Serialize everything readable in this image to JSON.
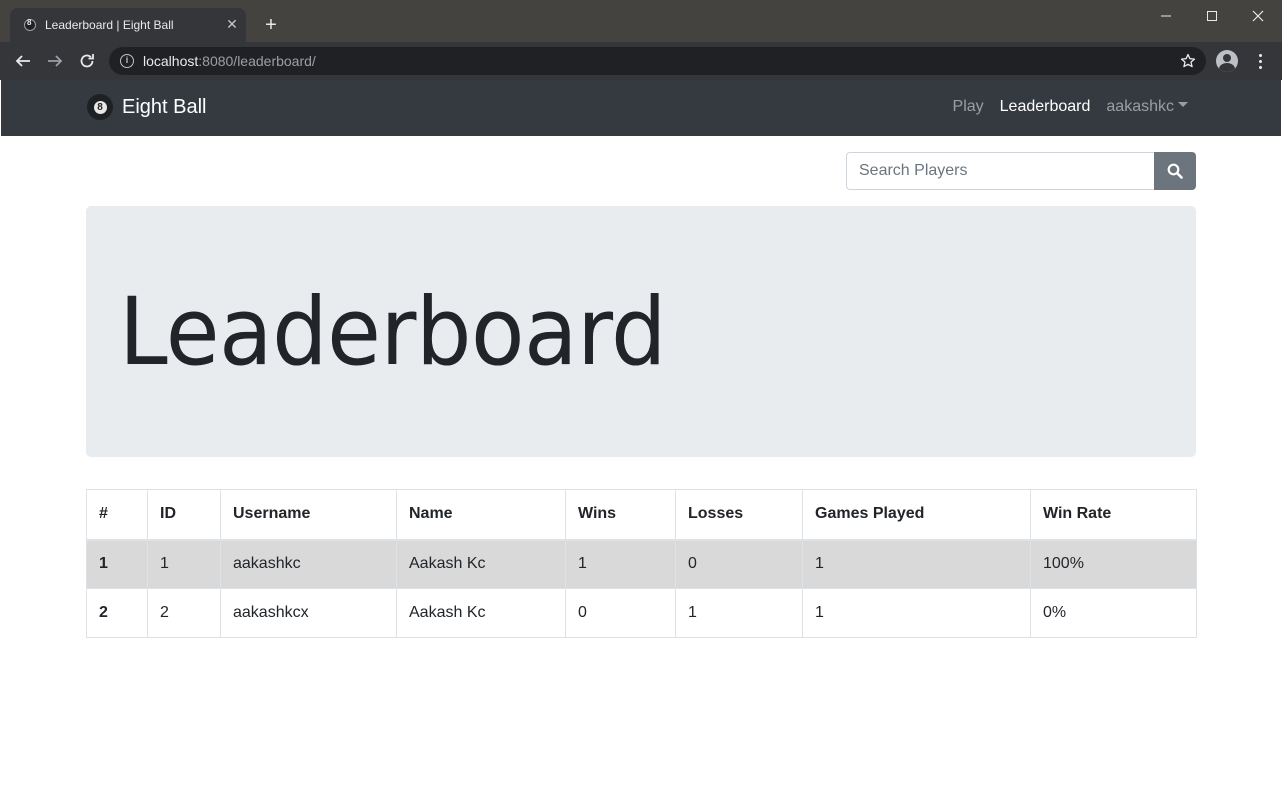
{
  "browser": {
    "tab_title": "Leaderboard | Eight Ball",
    "url_host": "localhost",
    "url_rest": ":8080/leaderboard/"
  },
  "navbar": {
    "brand": "Eight Ball",
    "brand_ball_number": "8",
    "links": {
      "play": "Play",
      "leaderboard": "Leaderboard",
      "user": "aakashkc"
    }
  },
  "search": {
    "placeholder": "Search Players"
  },
  "jumbotron": {
    "title": "Leaderboard"
  },
  "table": {
    "headers": [
      "#",
      "ID",
      "Username",
      "Name",
      "Wins",
      "Losses",
      "Games Played",
      "Win Rate"
    ],
    "rows": [
      [
        "1",
        "1",
        "aakashkc",
        "Aakash Kc",
        "1",
        "0",
        "1",
        "100%"
      ],
      [
        "2",
        "2",
        "aakashkcx",
        "Aakash Kc",
        "0",
        "1",
        "1",
        "0%"
      ]
    ]
  },
  "colors": {
    "navbar_bg": "#343a40",
    "jumbotron_bg": "#e9ecef",
    "search_button_bg": "#6c757d",
    "highlight_row_bg": "#d9d9d9"
  }
}
